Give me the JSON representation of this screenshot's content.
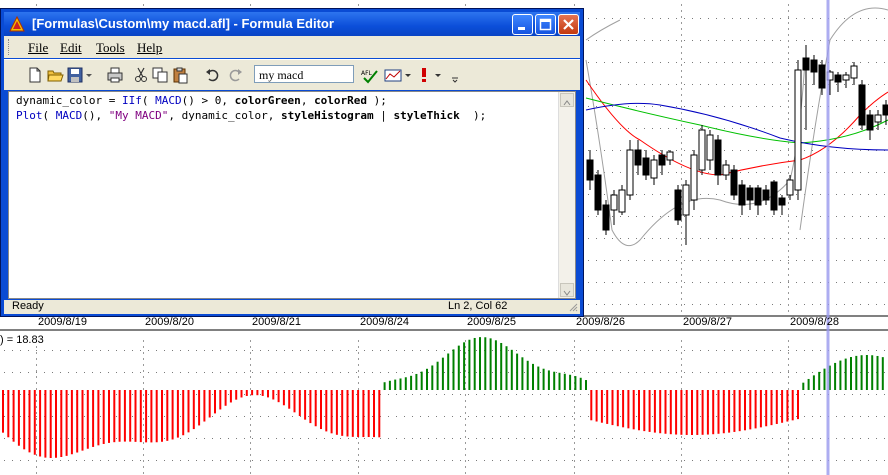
{
  "window": {
    "title": "[Formulas\\Custom\\my macd.afl] - Formula Editor",
    "menus": [
      "File",
      "Edit",
      "Tools",
      "Help"
    ],
    "formula_name": "my macd",
    "status_left": "Ready",
    "status_right": "Ln 2, Col 62"
  },
  "code": {
    "line1": [
      {
        "t": "dynamic_color = ",
        "c": "plain"
      },
      {
        "t": "IIf",
        "c": "kw"
      },
      {
        "t": "( ",
        "c": "plain"
      },
      {
        "t": "MACD",
        "c": "kw"
      },
      {
        "t": "() > 0, ",
        "c": "plain"
      },
      {
        "t": "colorGreen",
        "c": "bold"
      },
      {
        "t": ", ",
        "c": "plain"
      },
      {
        "t": "colorRed",
        "c": "bold"
      },
      {
        "t": " );",
        "c": "plain"
      }
    ],
    "line2": [
      {
        "t": "Plot",
        "c": "kw"
      },
      {
        "t": "( ",
        "c": "plain"
      },
      {
        "t": "MACD",
        "c": "kw"
      },
      {
        "t": "(), ",
        "c": "plain"
      },
      {
        "t": "\"My MACD\"",
        "c": "str"
      },
      {
        "t": ", dynamic_color, ",
        "c": "plain"
      },
      {
        "t": "styleHistogram",
        "c": "bold"
      },
      {
        "t": " | ",
        "c": "plain"
      },
      {
        "t": "styleThick",
        "c": "bold"
      },
      {
        "t": "  );",
        "c": "plain"
      }
    ]
  },
  "chart": {
    "dates": [
      "2009/8/19",
      "2009/8/20",
      "2009/8/21",
      "2009/8/24",
      "2009/8/25",
      "2009/8/26",
      "2009/8/27",
      "2009/8/28"
    ],
    "macd_readout": ") = 18.83",
    "colors": {
      "up": "#008000",
      "down": "#ff0000",
      "ma_red": "#ff0000",
      "ma_green": "#00c000",
      "ma_blue": "#0000c0",
      "cursor": "#9999ee"
    }
  }
}
